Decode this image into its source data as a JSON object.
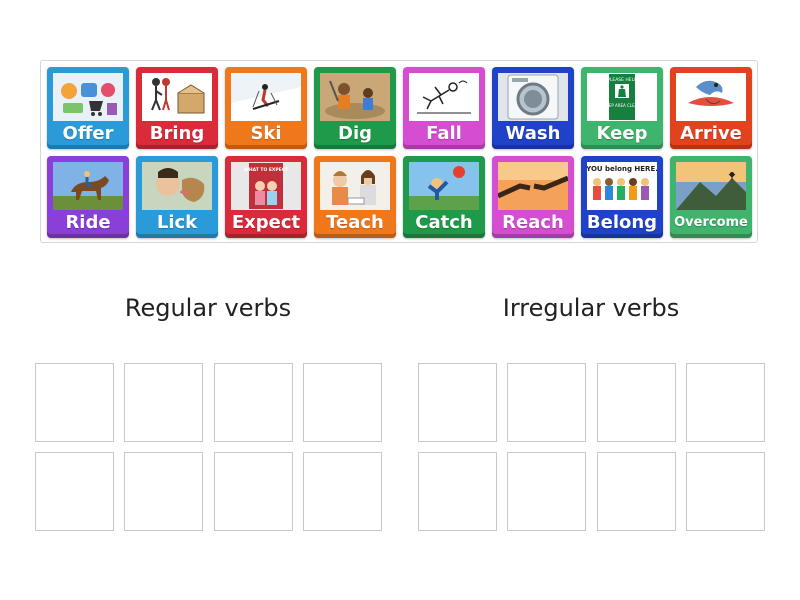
{
  "tray_cards": [
    {
      "label": "Offer",
      "color": "#2a9bd8",
      "icon": "shopping-icons-image"
    },
    {
      "label": "Bring",
      "color": "#d92b3a",
      "icon": "carrying-box-image"
    },
    {
      "label": "Ski",
      "color": "#f0781c",
      "icon": "skier-image"
    },
    {
      "label": "Dig",
      "color": "#1e9a4a",
      "icon": "digging-image"
    },
    {
      "label": "Fall",
      "color": "#d54dd1",
      "icon": "falling-person-image"
    },
    {
      "label": "Wash",
      "color": "#1f42c8",
      "icon": "washing-machine-image"
    },
    {
      "label": "Keep",
      "color": "#3fb46c",
      "icon": "keep-area-clean-sign-image"
    },
    {
      "label": "Arrive",
      "color": "#e2431f",
      "icon": "arrive-bird-image"
    },
    {
      "label": "Ride",
      "color": "#8a3fd8",
      "icon": "horse-rider-image"
    },
    {
      "label": "Lick",
      "color": "#2a9bd8",
      "icon": "dog-licking-image"
    },
    {
      "label": "Expect",
      "color": "#d92b3a",
      "icon": "book-cover-image"
    },
    {
      "label": "Teach",
      "color": "#f0781c",
      "icon": "teacher-student-image"
    },
    {
      "label": "Catch",
      "color": "#1e9a4a",
      "icon": "catching-ball-image"
    },
    {
      "label": "Reach",
      "color": "#d54dd1",
      "icon": "reaching-hands-image"
    },
    {
      "label": "Belong",
      "color": "#1f42c8",
      "icon": "you-belong-here-image"
    },
    {
      "label": "Overcome",
      "color": "#3fb46c",
      "icon": "mountain-summit-image"
    }
  ],
  "image_texts": {
    "keep_sign_top": "PLEASE HELP",
    "keep_sign_bottom": "KEEP AREA CLEAN",
    "belong_banner": "YOU belong HERE.",
    "expect_book": "WHAT TO EXPECT"
  },
  "groups": {
    "regular": {
      "title": "Regular verbs"
    },
    "irregular": {
      "title": "Irregular verbs"
    }
  }
}
